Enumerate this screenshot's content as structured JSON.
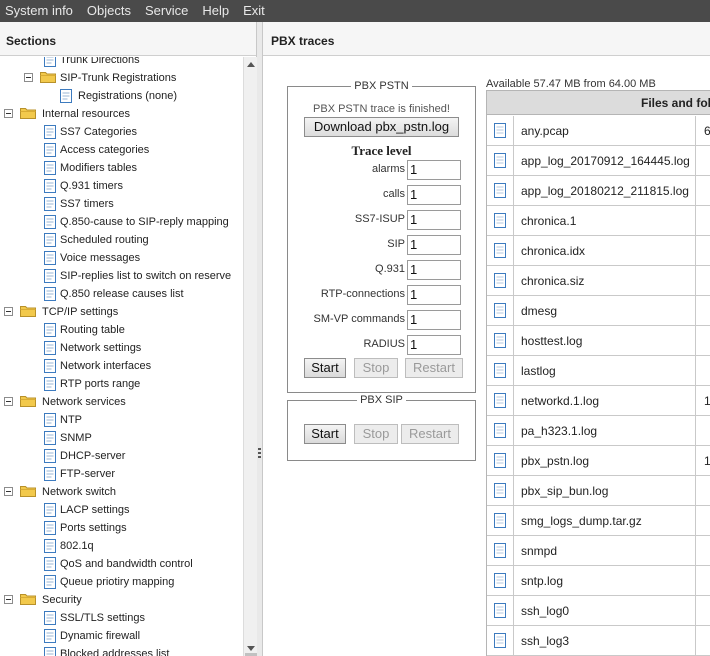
{
  "menu": [
    "System info",
    "Objects",
    "Service",
    "Help",
    "Exit"
  ],
  "sections_title": "Sections",
  "tree": [
    {
      "label": "Trunk Directions",
      "type": "doc",
      "level": 2
    },
    {
      "label": "SIP-Trunk Registrations",
      "type": "folder",
      "level": 2
    },
    {
      "label": "Registrations (none)",
      "type": "doc",
      "level": 3
    },
    {
      "label": "Internal resources",
      "type": "folder",
      "level": 1
    },
    {
      "label": "SS7 Categories",
      "type": "doc",
      "level": 2
    },
    {
      "label": "Access categories",
      "type": "doc",
      "level": 2
    },
    {
      "label": "Modifiers tables",
      "type": "doc",
      "level": 2
    },
    {
      "label": "Q.931 timers",
      "type": "doc",
      "level": 2
    },
    {
      "label": "SS7 timers",
      "type": "doc",
      "level": 2
    },
    {
      "label": "Q.850-cause to SIP-reply mapping",
      "type": "doc",
      "level": 2
    },
    {
      "label": "Scheduled routing",
      "type": "doc",
      "level": 2
    },
    {
      "label": "Voice messages",
      "type": "doc",
      "level": 2
    },
    {
      "label": "SIP-replies list to switch on reserve",
      "type": "doc",
      "level": 2
    },
    {
      "label": "Q.850 release causes list",
      "type": "doc",
      "level": 2
    },
    {
      "label": "TCP/IP settings",
      "type": "folder",
      "level": 1
    },
    {
      "label": "Routing table",
      "type": "doc",
      "level": 2
    },
    {
      "label": "Network settings",
      "type": "doc",
      "level": 2
    },
    {
      "label": "Network interfaces",
      "type": "doc",
      "level": 2
    },
    {
      "label": "RTP ports range",
      "type": "doc",
      "level": 2
    },
    {
      "label": "Network services",
      "type": "folder",
      "level": 1
    },
    {
      "label": "NTP",
      "type": "doc",
      "level": 2
    },
    {
      "label": "SNMP",
      "type": "doc",
      "level": 2
    },
    {
      "label": "DHCP-server",
      "type": "doc",
      "level": 2
    },
    {
      "label": "FTP-server",
      "type": "doc",
      "level": 2
    },
    {
      "label": "Network switch",
      "type": "folder",
      "level": 1
    },
    {
      "label": "LACP settings",
      "type": "doc",
      "level": 2
    },
    {
      "label": "Ports settings",
      "type": "doc",
      "level": 2
    },
    {
      "label": "802.1q",
      "type": "doc",
      "level": 2
    },
    {
      "label": "QoS and bandwidth control",
      "type": "doc",
      "level": 2
    },
    {
      "label": "Queue priotiry mapping",
      "type": "doc",
      "level": 2
    },
    {
      "label": "Security",
      "type": "folder",
      "level": 1
    },
    {
      "label": "SSL/TLS settings",
      "type": "doc",
      "level": 2
    },
    {
      "label": "Dynamic firewall",
      "type": "doc",
      "level": 2
    },
    {
      "label": "Blocked addresses list",
      "type": "doc",
      "level": 2
    }
  ],
  "page_title": "PBX traces",
  "pstn": {
    "legend": "PBX PSTN",
    "status": "PBX PSTN trace is finished!",
    "download_label": "Download pbx_pstn.log",
    "trace_level_title": "Trace level",
    "levels": [
      {
        "label": "alarms",
        "value": "1"
      },
      {
        "label": "calls",
        "value": "1"
      },
      {
        "label": "SS7-ISUP",
        "value": "1"
      },
      {
        "label": "SIP",
        "value": "1"
      },
      {
        "label": "Q.931",
        "value": "1"
      },
      {
        "label": "RTP-connections",
        "value": "1"
      },
      {
        "label": "SM-VP commands",
        "value": "1"
      },
      {
        "label": "RADIUS",
        "value": "1"
      }
    ],
    "start": "Start",
    "stop": "Stop",
    "restart": "Restart"
  },
  "sip": {
    "legend": "PBX SIP",
    "start": "Start",
    "stop": "Stop",
    "restart": "Restart"
  },
  "available": "Available 57.47 MB from 64.00 MB",
  "files_header": "Files and fol",
  "files": [
    {
      "name": "any.pcap",
      "size": "6"
    },
    {
      "name": "app_log_20170912_164445.log",
      "size": ""
    },
    {
      "name": "app_log_20180212_211815.log",
      "size": ""
    },
    {
      "name": "chronica.1",
      "size": ""
    },
    {
      "name": "chronica.idx",
      "size": ""
    },
    {
      "name": "chronica.siz",
      "size": ""
    },
    {
      "name": "dmesg",
      "size": ""
    },
    {
      "name": "hosttest.log",
      "size": ""
    },
    {
      "name": "lastlog",
      "size": ""
    },
    {
      "name": "networkd.1.log",
      "size": "1:"
    },
    {
      "name": "pa_h323.1.log",
      "size": ""
    },
    {
      "name": "pbx_pstn.log",
      "size": "1"
    },
    {
      "name": "pbx_sip_bun.log",
      "size": ""
    },
    {
      "name": "smg_logs_dump.tar.gz",
      "size": ""
    },
    {
      "name": "snmpd",
      "size": ""
    },
    {
      "name": "sntp.log",
      "size": ""
    },
    {
      "name": "ssh_log0",
      "size": ""
    },
    {
      "name": "ssh_log3",
      "size": ""
    }
  ],
  "colors": {
    "menubar": "#4a4a4a",
    "folder": "#f2c94c",
    "doc_border": "#3d7bbf"
  }
}
